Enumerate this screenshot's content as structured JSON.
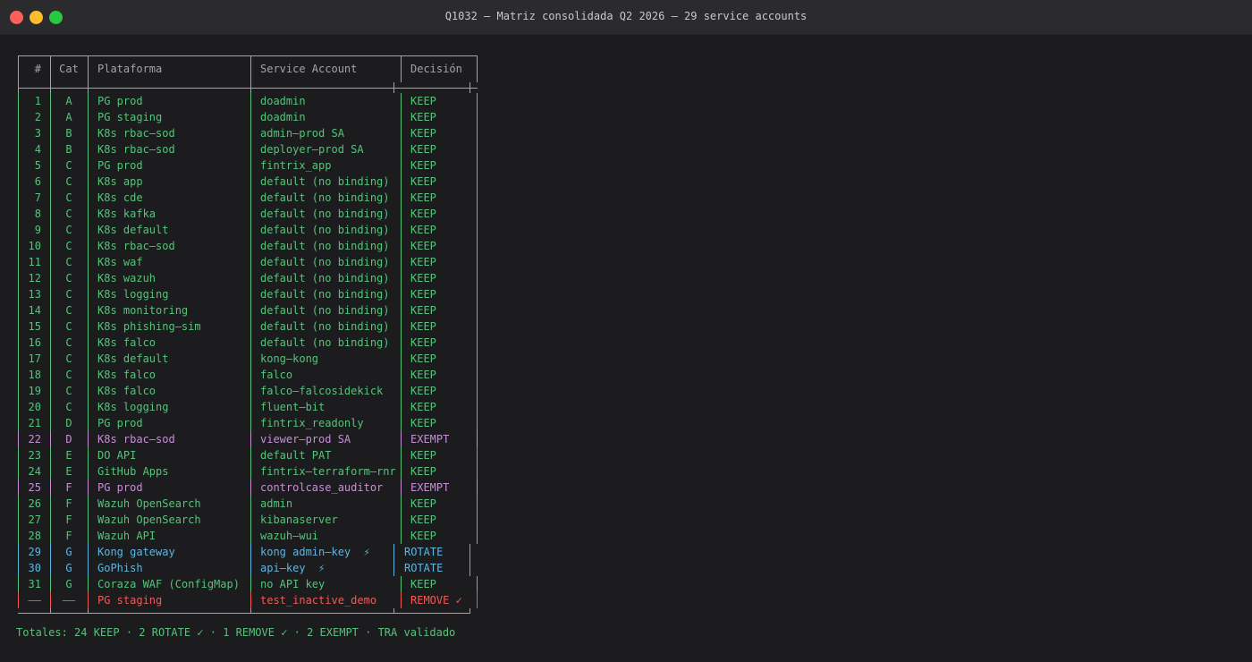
{
  "window": {
    "title": "Q1032 — Matriz consolidada Q2 2026 — 29 service accounts"
  },
  "table": {
    "headers": {
      "num": "#",
      "cat": "Cat",
      "plat": "Plataforma",
      "sa": "Service Account",
      "dec": "Decisión"
    },
    "rows": [
      {
        "num": "1",
        "cat": "A",
        "plat": "PG prod",
        "sa": "doadmin",
        "dec": "KEEP",
        "kind": "keep"
      },
      {
        "num": "2",
        "cat": "A",
        "plat": "PG staging",
        "sa": "doadmin",
        "dec": "KEEP",
        "kind": "keep"
      },
      {
        "num": "3",
        "cat": "B",
        "plat": "K8s rbac–sod",
        "sa": "admin–prod SA",
        "dec": "KEEP",
        "kind": "keep"
      },
      {
        "num": "4",
        "cat": "B",
        "plat": "K8s rbac–sod",
        "sa": "deployer–prod SA",
        "dec": "KEEP",
        "kind": "keep"
      },
      {
        "num": "5",
        "cat": "C",
        "plat": "PG prod",
        "sa": "fintrix_app",
        "dec": "KEEP",
        "kind": "keep"
      },
      {
        "num": "6",
        "cat": "C",
        "plat": "K8s app",
        "sa": "default (no binding)",
        "dec": "KEEP",
        "kind": "keep"
      },
      {
        "num": "7",
        "cat": "C",
        "plat": "K8s cde",
        "sa": "default (no binding)",
        "dec": "KEEP",
        "kind": "keep"
      },
      {
        "num": "8",
        "cat": "C",
        "plat": "K8s kafka",
        "sa": "default (no binding)",
        "dec": "KEEP",
        "kind": "keep"
      },
      {
        "num": "9",
        "cat": "C",
        "plat": "K8s default",
        "sa": "default (no binding)",
        "dec": "KEEP",
        "kind": "keep"
      },
      {
        "num": "10",
        "cat": "C",
        "plat": "K8s rbac–sod",
        "sa": "default (no binding)",
        "dec": "KEEP",
        "kind": "keep"
      },
      {
        "num": "11",
        "cat": "C",
        "plat": "K8s waf",
        "sa": "default (no binding)",
        "dec": "KEEP",
        "kind": "keep"
      },
      {
        "num": "12",
        "cat": "C",
        "plat": "K8s wazuh",
        "sa": "default (no binding)",
        "dec": "KEEP",
        "kind": "keep"
      },
      {
        "num": "13",
        "cat": "C",
        "plat": "K8s logging",
        "sa": "default (no binding)",
        "dec": "KEEP",
        "kind": "keep"
      },
      {
        "num": "14",
        "cat": "C",
        "plat": "K8s monitoring",
        "sa": "default (no binding)",
        "dec": "KEEP",
        "kind": "keep"
      },
      {
        "num": "15",
        "cat": "C",
        "plat": "K8s phishing–sim",
        "sa": "default (no binding)",
        "dec": "KEEP",
        "kind": "keep"
      },
      {
        "num": "16",
        "cat": "C",
        "plat": "K8s falco",
        "sa": "default (no binding)",
        "dec": "KEEP",
        "kind": "keep"
      },
      {
        "num": "17",
        "cat": "C",
        "plat": "K8s default",
        "sa": "kong–kong",
        "dec": "KEEP",
        "kind": "keep"
      },
      {
        "num": "18",
        "cat": "C",
        "plat": "K8s falco",
        "sa": "falco",
        "dec": "KEEP",
        "kind": "keep"
      },
      {
        "num": "19",
        "cat": "C",
        "plat": "K8s falco",
        "sa": "falco–falcosidekick",
        "dec": "KEEP",
        "kind": "keep"
      },
      {
        "num": "20",
        "cat": "C",
        "plat": "K8s logging",
        "sa": "fluent–bit",
        "dec": "KEEP",
        "kind": "keep"
      },
      {
        "num": "21",
        "cat": "D",
        "plat": "PG prod",
        "sa": "fintrix_readonly",
        "dec": "KEEP",
        "kind": "keep"
      },
      {
        "num": "22",
        "cat": "D",
        "plat": "K8s rbac–sod",
        "sa": "viewer–prod SA",
        "dec": "EXEMPT",
        "kind": "exempt"
      },
      {
        "num": "23",
        "cat": "E",
        "plat": "DO API",
        "sa": "default PAT",
        "dec": "KEEP",
        "kind": "keep"
      },
      {
        "num": "24",
        "cat": "E",
        "plat": "GitHub Apps",
        "sa": "fintrix–terraform–rnr",
        "dec": "KEEP",
        "kind": "keep"
      },
      {
        "num": "25",
        "cat": "F",
        "plat": "PG prod",
        "sa": "controlcase_auditor",
        "dec": "EXEMPT",
        "kind": "exempt"
      },
      {
        "num": "26",
        "cat": "F",
        "plat": "Wazuh OpenSearch",
        "sa": "admin",
        "dec": "KEEP",
        "kind": "keep"
      },
      {
        "num": "27",
        "cat": "F",
        "plat": "Wazuh OpenSearch",
        "sa": "kibanaserver",
        "dec": "KEEP",
        "kind": "keep"
      },
      {
        "num": "28",
        "cat": "F",
        "plat": "Wazuh API",
        "sa": "wazuh–wui",
        "dec": "KEEP",
        "kind": "keep"
      },
      {
        "num": "29",
        "cat": "G",
        "plat": "Kong gateway",
        "sa": "kong admin–key  ⚡",
        "dec": "ROTATE",
        "kind": "rotate"
      },
      {
        "num": "30",
        "cat": "G",
        "plat": "GoPhish",
        "sa": "api–key  ⚡",
        "dec": "ROTATE",
        "kind": "rotate"
      },
      {
        "num": "31",
        "cat": "G",
        "plat": "Coraza WAF (ConfigMap)",
        "sa": "no API key",
        "dec": "KEEP",
        "kind": "keep"
      },
      {
        "num": "——",
        "cat": "——",
        "plat": "PG staging",
        "sa": "test_inactive_demo",
        "dec": "REMOVE ✓",
        "kind": "remove"
      }
    ]
  },
  "totals": "Totales: 24 KEEP · 2 ROTATE ✓ · 1 REMOVE ✓ · 2 EXEMPT · TRA validado",
  "colors": {
    "keep": "#57c27a",
    "exempt": "#c58fd6",
    "rotate": "#5fb4e0",
    "remove": "#ef5a56",
    "border": "#a4a4a8"
  }
}
